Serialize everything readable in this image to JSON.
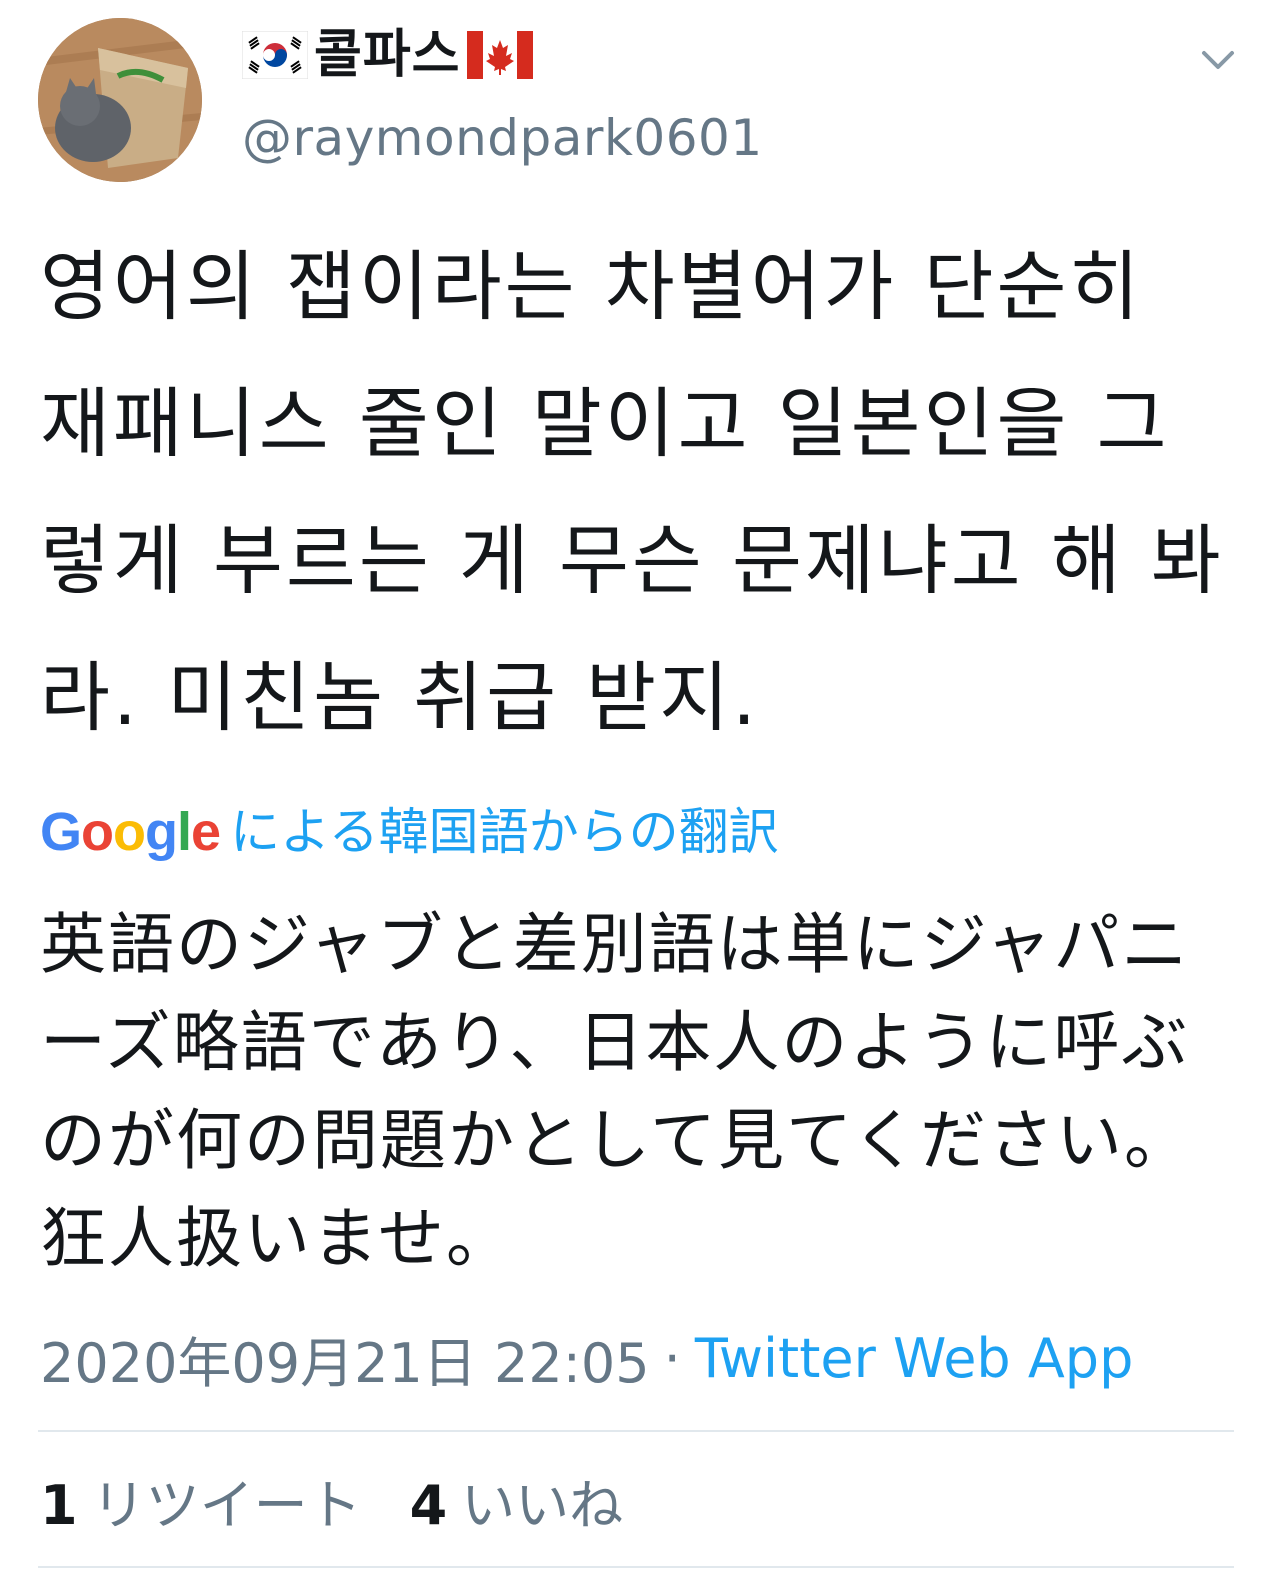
{
  "author": {
    "display_name": "콜파스",
    "handle": "@raymondpark0601",
    "flags": [
      "flag-south-korea-icon",
      "flag-canada-icon"
    ]
  },
  "tweet": {
    "text": "영어의 잽이라는 차별어가 단순히 재패니스 줄인 말이고 일본인을 그렇게 부르는 게 무슨 문제냐고 해 봐라. 미친놈 취급 받지.",
    "translation_label": "による韓国語からの翻訳",
    "translation_provider": [
      "G",
      "o",
      "o",
      "g",
      "l",
      "e"
    ],
    "translation": "英語のジャブと差別語は単にジャパニーズ略語であり、日本人のように呼ぶのが何の問題かとして見てください。狂人扱いませ。",
    "timestamp": "2020年09月21日 22:05",
    "separator": "·",
    "source": "Twitter Web App"
  },
  "stats": {
    "retweets_count": "1",
    "retweets_label": "リツイート",
    "likes_count": "4",
    "likes_label": "いいね"
  },
  "colors": {
    "link": "#1da1f2",
    "secondary_text": "#657786",
    "divider": "#e1e8ed"
  }
}
